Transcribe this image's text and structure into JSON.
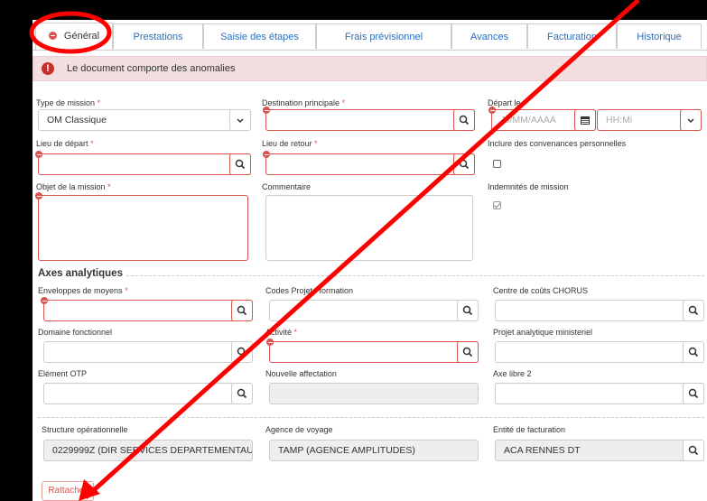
{
  "tabs": [
    {
      "label": "Général",
      "active": true
    },
    {
      "label": "Prestations"
    },
    {
      "label": "Saisie des étapes"
    },
    {
      "label": "Frais prévisionnel"
    },
    {
      "label": "Avances"
    },
    {
      "label": "Facturation"
    },
    {
      "label": "Historique"
    }
  ],
  "alert": {
    "text": "Le document comporte des anomalies",
    "icon": "exclamation-icon"
  },
  "fields": {
    "type_mission": {
      "label": "Type de mission",
      "value": "OM Classique"
    },
    "destination": {
      "label": "Destination principale"
    },
    "depart": {
      "label": "Départ le",
      "date_placeholder": "JJ/MM/AAAA",
      "time_placeholder": "HH:Mi"
    },
    "lieu_depart": {
      "label": "Lieu de départ"
    },
    "lieu_retour": {
      "label": "Lieu de retour"
    },
    "convenances": {
      "label": "Inclure des convenances personnelles"
    },
    "objet": {
      "label": "Objet de la mission"
    },
    "commentaire": {
      "label": "Commentaire"
    },
    "indemnites": {
      "label": "Indemnités de mission"
    }
  },
  "analytique": {
    "title": "Axes analytiques",
    "enveloppes": "Enveloppes de moyens",
    "codes_projet": "Codes Projet / formation",
    "centre_couts": "Centre de coûts CHORUS",
    "domaine": "Domaine fonctionnel",
    "activite": "Activité",
    "projet_min": "Projet analytique ministeriel",
    "element_otp": "Elément OTP",
    "nouvelle_aff": "Nouvelle affectation",
    "axe_libre": "Axe libre 2"
  },
  "org": {
    "structure_label": "Structure opérationnelle",
    "structure_value": "0229999Z (DIR SERVICES DEPARTEMENTAU",
    "agence_label": "Agence de voyage",
    "agence_value": "TAMP (AGENCE AMPLITUDES)",
    "entite_label": "Entité de facturation",
    "entite_value": "ACA RENNES DT"
  },
  "buttons": {
    "rattacher": "Rattacher"
  },
  "colors": {
    "error": "#d9534f",
    "link": "#2a6ebb",
    "annotation": "#ff0000"
  }
}
